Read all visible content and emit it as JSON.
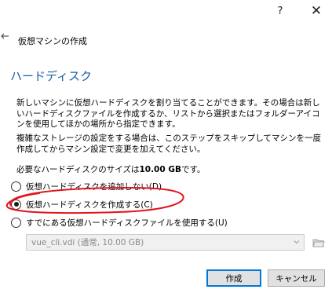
{
  "titlebar": {
    "help_label": "?",
    "close_label": "✕"
  },
  "wizard": {
    "title": "仮想マシンの作成",
    "heading": "ハードディスク",
    "paragraph1": "新しいマシンに仮想ハードディスクを割り当てることができます。その場合は新しいハードディスクファイルを作成するか、リストから選択またはフォルダーアイコンを使用してほかの場所から指定できます。",
    "paragraph2": "複雑なストレージの設定をする場合は、このステップをスキップしてマシンを一度作成してからマシン設定で変更を加えてください。",
    "size_prefix": "必要なハードディスクのサイズは",
    "size_value": "10.00 GB",
    "size_suffix": "です。"
  },
  "options": [
    {
      "label": "仮想ハードディスクを追加しない(D)",
      "checked": false
    },
    {
      "label": "仮想ハードディスクを作成する(C)",
      "checked": true
    },
    {
      "label": "すでにある仮想ハードディスクファイルを使用する(U)",
      "checked": false
    }
  ],
  "disk_select": {
    "value": "vue_cli.vdi (通常, 10.00 GB)",
    "disabled": true
  },
  "buttons": {
    "create": "作成",
    "cancel": "キャンセル"
  },
  "colors": {
    "heading": "#1b5ea8",
    "annotation": "#e3141b",
    "default_button_border": "#0078d7"
  },
  "icons": {
    "back": "arrow-left-icon",
    "folder": "folder-open-icon",
    "combo_arrow": "chevron-down-icon"
  }
}
